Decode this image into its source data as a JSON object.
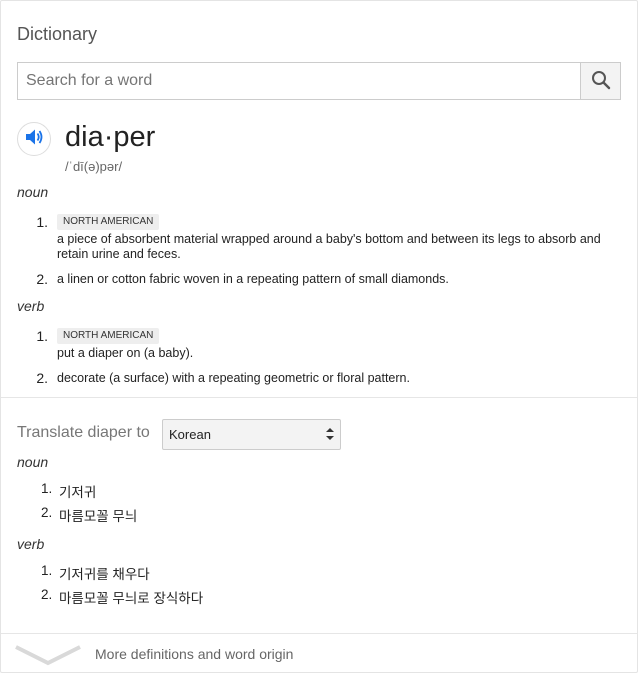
{
  "header": {
    "title": "Dictionary"
  },
  "search": {
    "placeholder": "Search for a word",
    "value": ""
  },
  "entry": {
    "headword": "dia·per",
    "phonetic": "/ˈdī(ə)pər/"
  },
  "noun": {
    "label": "noun",
    "senses": [
      {
        "num": "1.",
        "tag": "NORTH AMERICAN",
        "line1": "a piece of absorbent material wrapped around a baby's bottom and between its legs to absorb and",
        "line2": "retain urine and feces."
      },
      {
        "num": "2.",
        "text": "a linen or cotton fabric woven in a repeating pattern of small diamonds."
      }
    ]
  },
  "verb": {
    "label": "verb",
    "senses": [
      {
        "num": "1.",
        "tag": "NORTH AMERICAN",
        "text": "put a diaper on (a baby)."
      },
      {
        "num": "2.",
        "text": "decorate (a surface) with a repeating geometric or floral pattern."
      }
    ]
  },
  "translate": {
    "label": "Translate diaper to",
    "language": "Korean",
    "noun_label": "noun",
    "noun": [
      {
        "num": "1.",
        "text": "기저귀"
      },
      {
        "num": "2.",
        "text": "마름모꼴 무늬"
      }
    ],
    "verb_label": "verb",
    "verb": [
      {
        "num": "1.",
        "text": "기저귀를 채우다"
      },
      {
        "num": "2.",
        "text": "마름모꼴 무늬로 장식하다"
      }
    ]
  },
  "footer": {
    "more_label": "More definitions and word origin"
  },
  "icons": {
    "search": "search-icon",
    "speaker": "speaker-icon",
    "expand": "chevron-down-icon"
  },
  "colors": {
    "accent": "#1a73e8"
  }
}
